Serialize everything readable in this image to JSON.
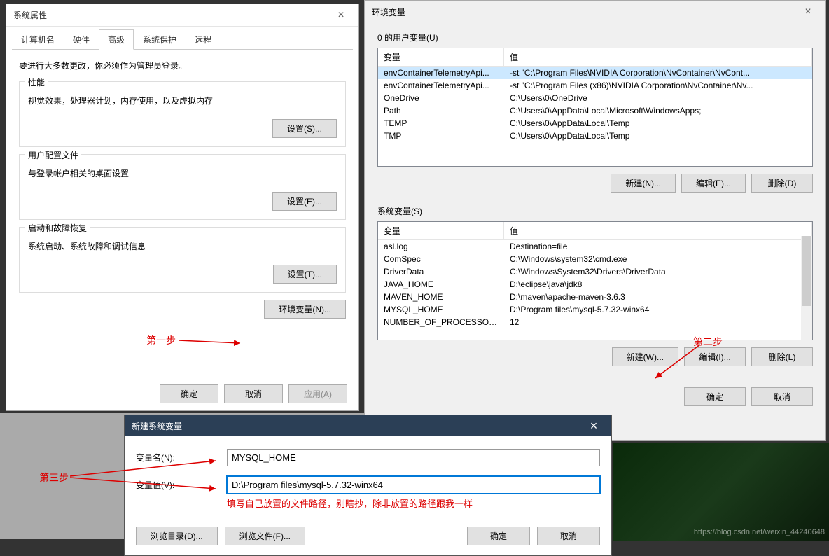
{
  "sysprop": {
    "title": "系统属性",
    "tabs": [
      "计算机名",
      "硬件",
      "高级",
      "系统保护",
      "远程"
    ],
    "active_tab_index": 2,
    "admin_note": "要进行大多数更改，你必须作为管理员登录。",
    "perf": {
      "legend": "性能",
      "text": "视觉效果，处理器计划，内存使用，以及虚拟内存",
      "btn": "设置(S)..."
    },
    "profile": {
      "legend": "用户配置文件",
      "text": "与登录帐户相关的桌面设置",
      "btn": "设置(E)..."
    },
    "startup": {
      "legend": "启动和故障恢复",
      "text": "系统启动、系统故障和调试信息",
      "btn": "设置(T)..."
    },
    "envvar_btn": "环境变量(N)...",
    "footer": {
      "ok": "确定",
      "cancel": "取消",
      "apply": "应用(A)"
    }
  },
  "envdlg": {
    "title": "环境变量",
    "user_section": "0 的用户变量(U)",
    "sys_section": "系统变量(S)",
    "cols": {
      "var": "变量",
      "val": "值"
    },
    "user_vars": [
      {
        "name": "envContainerTelemetryApi...",
        "value": "-st \"C:\\Program Files\\NVIDIA Corporation\\NvContainer\\NvCont..."
      },
      {
        "name": "envContainerTelemetryApi...",
        "value": "-st \"C:\\Program Files (x86)\\NVIDIA Corporation\\NvContainer\\Nv..."
      },
      {
        "name": "OneDrive",
        "value": "C:\\Users\\0\\OneDrive"
      },
      {
        "name": "Path",
        "value": "C:\\Users\\0\\AppData\\Local\\Microsoft\\WindowsApps;"
      },
      {
        "name": "TEMP",
        "value": "C:\\Users\\0\\AppData\\Local\\Temp"
      },
      {
        "name": "TMP",
        "value": "C:\\Users\\0\\AppData\\Local\\Temp"
      }
    ],
    "sys_vars": [
      {
        "name": "asl.log",
        "value": "Destination=file"
      },
      {
        "name": "ComSpec",
        "value": "C:\\Windows\\system32\\cmd.exe"
      },
      {
        "name": "DriverData",
        "value": "C:\\Windows\\System32\\Drivers\\DriverData"
      },
      {
        "name": "JAVA_HOME",
        "value": "D:\\eclipse\\java\\jdk8"
      },
      {
        "name": "MAVEN_HOME",
        "value": "D:\\maven\\apache-maven-3.6.3"
      },
      {
        "name": "MYSQL_HOME",
        "value": "D:\\Program files\\mysql-5.7.32-winx64"
      },
      {
        "name": "NUMBER_OF_PROCESSORS",
        "value": "12"
      }
    ],
    "user_btns": {
      "new": "新建(N)...",
      "edit": "编辑(E)...",
      "del": "删除(D)"
    },
    "sys_btns": {
      "new": "新建(W)...",
      "edit": "编辑(I)...",
      "del": "删除(L)"
    },
    "footer": {
      "ok": "确定",
      "cancel": "取消"
    }
  },
  "newvar": {
    "title": "新建系统变量",
    "name_label": "变量名(N):",
    "name_value": "MYSQL_HOME",
    "val_label": "变量值(V):",
    "val_value": "D:\\Program files\\mysql-5.7.32-winx64",
    "helper": "填写自己放置的文件路径，别瞎抄，除非放置的路径跟我一样",
    "browse_dir": "浏览目录(D)...",
    "browse_file": "浏览文件(F)...",
    "ok": "确定",
    "cancel": "取消"
  },
  "annotations": {
    "step1": "第一步",
    "step2": "第二步",
    "step3": "第三步"
  },
  "watermark": "https://blog.csdn.net/weixin_44240648"
}
